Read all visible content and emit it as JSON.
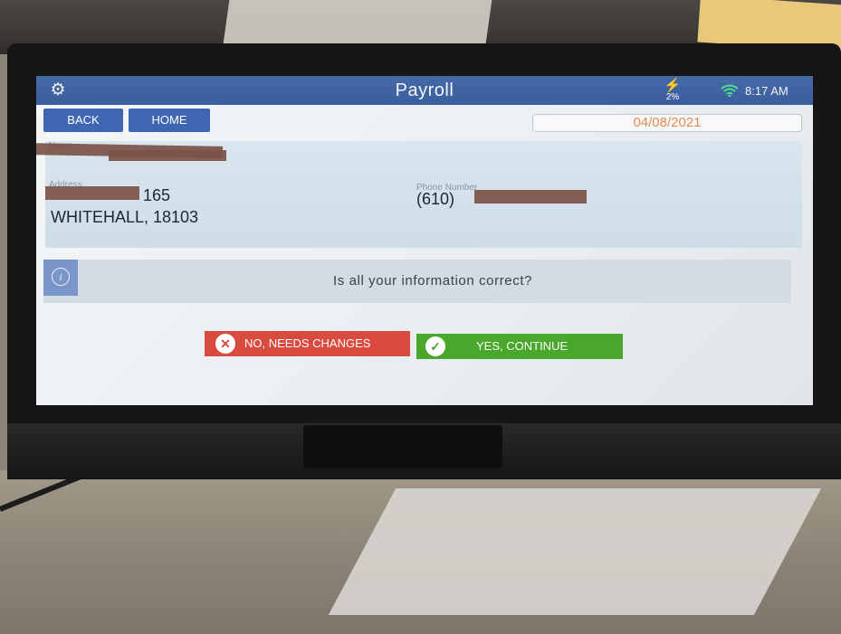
{
  "app": {
    "title": "Payroll",
    "battery_percent": "2%",
    "time": "8:17 AM"
  },
  "nav": {
    "back_label": "BACK",
    "home_label": "HOME"
  },
  "date": "04/08/2021",
  "employee": {
    "name_label": "Name",
    "address_label": "Address",
    "address_line1": "165",
    "address_line2": "WHITEHALL, 18103",
    "phone_label": "Phone Number",
    "phone_prefix": "(610)"
  },
  "notice": {
    "text": "Is all your information correct?"
  },
  "actions": {
    "no_label": "NO, NEEDS CHANGES",
    "yes_label": "YES, CONTINUE"
  },
  "icons": {
    "settings": "gear-icon",
    "battery": "charging-battery-icon",
    "wifi": "wifi-icon",
    "info": "info-icon",
    "no": "close-circle-icon",
    "yes": "check-circle-icon"
  },
  "colors": {
    "header": "#3b5e9c",
    "nav_button": "#3f67b1",
    "date_text": "#e38b57",
    "no_button": "#d94a3f",
    "yes_button": "#49a82c",
    "battery": "#8fdc4a",
    "wifi": "#4fe08a"
  }
}
